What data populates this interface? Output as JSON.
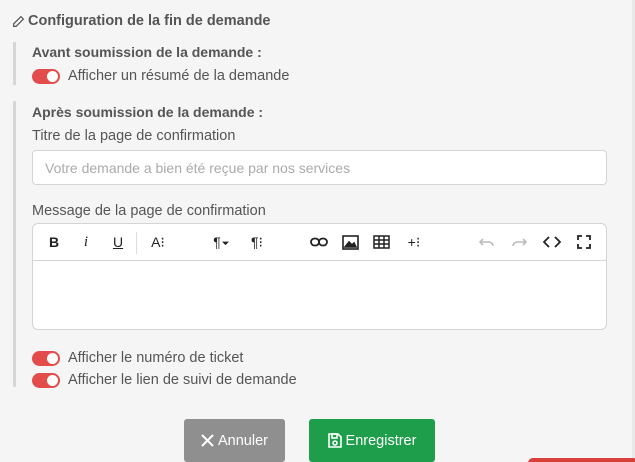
{
  "title": "Configuration de la fin de demande",
  "before": {
    "heading": "Avant soumission de la demande :",
    "toggle_label": "Afficher un résumé de la demande"
  },
  "after": {
    "heading": "Après soumission de la demande :",
    "confirm_title_label": "Titre de la page de confirmation",
    "confirm_title_placeholder": "Votre demande a bien été reçue par nos services",
    "confirm_message_label": "Message de la page de confirmation",
    "toggle_ticket_label": "Afficher le numéro de ticket",
    "toggle_tracking_label": "Afficher le lien de suivi de demande"
  },
  "toolbar": {
    "bold": "B",
    "italic": "i",
    "underline": "U",
    "font_size": "A⁝",
    "paragraph": "¶",
    "paragraph_format": "¶⁝",
    "insert_more": "+⁝"
  },
  "buttons": {
    "cancel": "Annuler",
    "save": "Enregistrer"
  },
  "colors": {
    "toggle_on": "#e24c4b",
    "save": "#1e9e4a",
    "cancel": "#8f8f8f"
  }
}
